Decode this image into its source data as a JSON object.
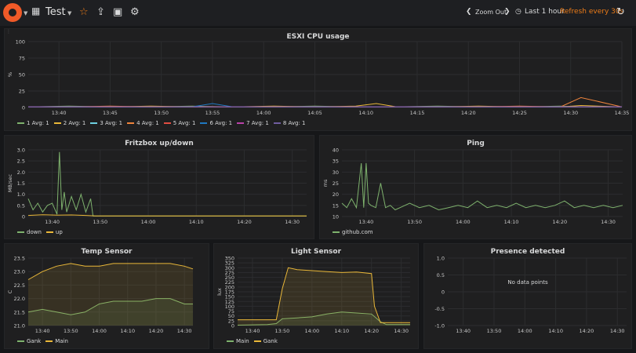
{
  "topbar": {
    "dashboard_title": "Test",
    "zoom_out_label": "Zoom Out",
    "time_range_label": "Last 1 hour",
    "refresh_label": "Refresh every 30s"
  },
  "colors": {
    "accent": "#eb7b18",
    "grid": "#2c2d2f",
    "green": "#7eb26d",
    "yellow": "#eab839"
  },
  "panels": {
    "esxi": {
      "title": "ESXI CPU usage",
      "legend": [
        {
          "label": "1  Avg: 1",
          "color": "#7eb26d"
        },
        {
          "label": "2  Avg: 1",
          "color": "#eab839"
        },
        {
          "label": "3  Avg: 1",
          "color": "#6ed0e0"
        },
        {
          "label": "4  Avg: 1",
          "color": "#ef843c"
        },
        {
          "label": "5  Avg: 1",
          "color": "#e24d42"
        },
        {
          "label": "6  Avg: 1",
          "color": "#1f78c1"
        },
        {
          "label": "7  Avg: 1",
          "color": "#ba43a9"
        },
        {
          "label": "8  Avg: 1",
          "color": "#705da0"
        }
      ]
    },
    "fritz": {
      "title": "Fritzbox up/down",
      "legend": [
        {
          "label": "down",
          "color": "#7eb26d"
        },
        {
          "label": "up",
          "color": "#eab839"
        }
      ]
    },
    "ping": {
      "title": "Ping",
      "legend": [
        {
          "label": "github.com",
          "color": "#7eb26d"
        }
      ]
    },
    "temp": {
      "title": "Temp Sensor",
      "legend": [
        {
          "label": "Gank",
          "color": "#7eb26d"
        },
        {
          "label": "Main",
          "color": "#eab839"
        }
      ]
    },
    "light": {
      "title": "Light Sensor",
      "legend": [
        {
          "label": "Main",
          "color": "#7eb26d"
        },
        {
          "label": "Gank",
          "color": "#eab839"
        }
      ]
    },
    "presence": {
      "title": "Presence detected",
      "no_data": "No data points"
    }
  },
  "chart_data": [
    {
      "id": "esxi",
      "type": "line",
      "title": "ESXI CPU usage",
      "ylabel": "%",
      "ylim": [
        0,
        100
      ],
      "yticks": [
        "0",
        "25",
        "50",
        "75",
        "100"
      ],
      "xlim": [
        0,
        58
      ],
      "xticks": [
        {
          "v": 3,
          "t": "13:40"
        },
        {
          "v": 8,
          "t": "13:45"
        },
        {
          "v": 13,
          "t": "13:50"
        },
        {
          "v": 18,
          "t": "13:55"
        },
        {
          "v": 23,
          "t": "14:00"
        },
        {
          "v": 28,
          "t": "14:05"
        },
        {
          "v": 33,
          "t": "14:10"
        },
        {
          "v": 38,
          "t": "14:15"
        },
        {
          "v": 43,
          "t": "14:20"
        },
        {
          "v": 48,
          "t": "14:25"
        },
        {
          "v": 53,
          "t": "14:30"
        },
        {
          "v": 58,
          "t": "14:35"
        }
      ],
      "series": [
        {
          "name": "1",
          "color": "#7eb26d",
          "x": [
            0,
            4,
            8,
            12,
            16,
            20,
            24,
            28,
            32,
            36,
            40,
            44,
            48,
            52,
            54,
            58
          ],
          "y": [
            1,
            2,
            1,
            1,
            2,
            1,
            1,
            2,
            1,
            1,
            2,
            1,
            1,
            2,
            1,
            1
          ]
        },
        {
          "name": "2",
          "color": "#eab839",
          "x": [
            0,
            4,
            8,
            12,
            16,
            20,
            24,
            28,
            32,
            34,
            36,
            40,
            44,
            48,
            52,
            54,
            58
          ],
          "y": [
            1,
            1,
            1,
            2,
            1,
            1,
            2,
            1,
            2,
            6,
            1,
            1,
            2,
            1,
            1,
            3,
            1
          ]
        },
        {
          "name": "3",
          "color": "#6ed0e0",
          "x": [
            0,
            4,
            8,
            12,
            16,
            20,
            24,
            28,
            32,
            36,
            40,
            44,
            48,
            52,
            58
          ],
          "y": [
            1,
            1,
            1,
            1,
            1,
            1,
            1,
            1,
            1,
            1,
            1,
            1,
            1,
            1,
            1
          ]
        },
        {
          "name": "4",
          "color": "#ef843c",
          "x": [
            0,
            4,
            8,
            12,
            16,
            20,
            24,
            28,
            32,
            36,
            40,
            44,
            48,
            52,
            54,
            58
          ],
          "y": [
            1,
            1,
            2,
            1,
            1,
            1,
            1,
            1,
            1,
            1,
            1,
            1,
            2,
            1,
            15,
            1
          ]
        },
        {
          "name": "5",
          "color": "#e24d42",
          "x": [
            0,
            4,
            8,
            12,
            16,
            20,
            24,
            28,
            32,
            36,
            40,
            44,
            48,
            52,
            58
          ],
          "y": [
            1,
            1,
            1,
            1,
            1,
            1,
            1,
            1,
            1,
            1,
            1,
            1,
            1,
            1,
            1
          ]
        },
        {
          "name": "6",
          "color": "#1f78c1",
          "x": [
            0,
            4,
            8,
            12,
            16,
            18,
            20,
            24,
            28,
            32,
            36,
            40,
            44,
            48,
            52,
            58
          ],
          "y": [
            1,
            1,
            1,
            1,
            1,
            6,
            1,
            1,
            1,
            1,
            1,
            1,
            1,
            1,
            1,
            1
          ]
        },
        {
          "name": "7",
          "color": "#ba43a9",
          "x": [
            0,
            4,
            8,
            12,
            16,
            20,
            24,
            28,
            32,
            36,
            40,
            44,
            48,
            52,
            58
          ],
          "y": [
            1,
            1,
            1,
            1,
            1,
            1,
            1,
            1,
            1,
            1,
            1,
            1,
            1,
            1,
            1
          ]
        },
        {
          "name": "8",
          "color": "#705da0",
          "x": [
            0,
            4,
            8,
            12,
            16,
            20,
            24,
            28,
            32,
            36,
            40,
            44,
            48,
            52,
            58
          ],
          "y": [
            1,
            1,
            1,
            1,
            1,
            1,
            1,
            1,
            1,
            1,
            1,
            1,
            1,
            1,
            1
          ]
        }
      ]
    },
    {
      "id": "fritz",
      "type": "line",
      "title": "Fritzbox up/down",
      "ylabel": "MB/sec",
      "ylim": [
        0,
        3.0
      ],
      "yticks": [
        "0",
        "0.5",
        "1.0",
        "1.5",
        "2.0",
        "2.5",
        "3.0"
      ],
      "xlim": [
        0,
        58
      ],
      "xticks": [
        {
          "v": 5,
          "t": "13:40"
        },
        {
          "v": 15,
          "t": "13:50"
        },
        {
          "v": 25,
          "t": "14:00"
        },
        {
          "v": 35,
          "t": "14:10"
        },
        {
          "v": 45,
          "t": "14:20"
        },
        {
          "v": 55,
          "t": "14:30"
        }
      ],
      "series": [
        {
          "name": "down",
          "color": "#7eb26d",
          "x": [
            0,
            1,
            2,
            3,
            4,
            5,
            6,
            6.5,
            7,
            7.5,
            8,
            9,
            10,
            11,
            12,
            13,
            13.5,
            58
          ],
          "y": [
            0.8,
            0.3,
            0.6,
            0.2,
            0.5,
            0.6,
            0.1,
            2.9,
            0.3,
            1.1,
            0.2,
            0.9,
            0.3,
            1.0,
            0.2,
            0.8,
            0.02,
            0.02
          ]
        },
        {
          "name": "up",
          "color": "#eab839",
          "x": [
            0,
            3,
            6,
            9,
            12,
            14,
            58
          ],
          "y": [
            0.05,
            0.08,
            0.06,
            0.07,
            0.05,
            0.03,
            0.03
          ]
        }
      ]
    },
    {
      "id": "ping",
      "type": "line",
      "title": "Ping",
      "ylabel": "ms",
      "ylim": [
        10,
        40
      ],
      "yticks": [
        "10",
        "15",
        "20",
        "25",
        "30",
        "35",
        "40"
      ],
      "xlim": [
        0,
        58
      ],
      "xticks": [
        {
          "v": 5,
          "t": "13:40"
        },
        {
          "v": 15,
          "t": "13:50"
        },
        {
          "v": 25,
          "t": "14:00"
        },
        {
          "v": 35,
          "t": "14:10"
        },
        {
          "v": 45,
          "t": "14:20"
        },
        {
          "v": 55,
          "t": "14:30"
        }
      ],
      "series": [
        {
          "name": "github.com",
          "color": "#7eb26d",
          "x": [
            0,
            1,
            2,
            3,
            4,
            4.5,
            5,
            5.5,
            6,
            7,
            8,
            9,
            10,
            11,
            12,
            14,
            16,
            18,
            20,
            22,
            24,
            26,
            28,
            30,
            32,
            34,
            36,
            38,
            40,
            42,
            44,
            46,
            48,
            50,
            52,
            54,
            56,
            58
          ],
          "y": [
            16,
            14,
            18,
            14,
            34,
            14,
            34,
            16,
            15,
            14,
            25,
            14,
            15,
            13,
            14,
            16,
            14,
            15,
            13,
            14,
            15,
            14,
            17,
            14,
            15,
            14,
            16,
            14,
            15,
            14,
            15,
            17,
            14,
            15,
            14,
            15,
            14,
            15
          ]
        }
      ]
    },
    {
      "id": "temp",
      "type": "area",
      "title": "Temp Sensor",
      "ylabel": "C",
      "ylim": [
        21.0,
        23.5
      ],
      "yticks": [
        "21.0",
        "21.5",
        "22.0",
        "22.5",
        "23.0",
        "23.5"
      ],
      "xlim": [
        0,
        58
      ],
      "xticks": [
        {
          "v": 5,
          "t": "13:40"
        },
        {
          "v": 15,
          "t": "13:50"
        },
        {
          "v": 25,
          "t": "14:00"
        },
        {
          "v": 35,
          "t": "14:10"
        },
        {
          "v": 45,
          "t": "14:20"
        },
        {
          "v": 55,
          "t": "14:30"
        }
      ],
      "series": [
        {
          "name": "Gank",
          "color": "#7eb26d",
          "x": [
            0,
            5,
            10,
            15,
            20,
            25,
            30,
            35,
            40,
            45,
            50,
            55,
            58
          ],
          "y": [
            21.5,
            21.6,
            21.5,
            21.4,
            21.5,
            21.8,
            21.9,
            21.9,
            21.9,
            22.0,
            22.0,
            21.8,
            21.8
          ]
        },
        {
          "name": "Main",
          "color": "#eab839",
          "x": [
            0,
            5,
            10,
            15,
            20,
            25,
            30,
            35,
            40,
            45,
            50,
            55,
            58
          ],
          "y": [
            22.7,
            23.0,
            23.2,
            23.3,
            23.2,
            23.2,
            23.3,
            23.3,
            23.3,
            23.3,
            23.3,
            23.2,
            23.1
          ]
        }
      ]
    },
    {
      "id": "light",
      "type": "area",
      "title": "Light Sensor",
      "ylabel": "lux",
      "ylim": [
        0,
        350
      ],
      "yticks": [
        "0",
        "25",
        "50",
        "75",
        "100",
        "125",
        "150",
        "175",
        "200",
        "225",
        "250",
        "275",
        "300",
        "325",
        "350"
      ],
      "xlim": [
        0,
        58
      ],
      "xticks": [
        {
          "v": 5,
          "t": "13:40"
        },
        {
          "v": 15,
          "t": "13:50"
        },
        {
          "v": 25,
          "t": "14:00"
        },
        {
          "v": 35,
          "t": "14:10"
        },
        {
          "v": 45,
          "t": "14:20"
        },
        {
          "v": 55,
          "t": "14:30"
        }
      ],
      "series": [
        {
          "name": "Main",
          "color": "#7eb26d",
          "x": [
            0,
            10,
            13,
            15,
            20,
            25,
            30,
            35,
            40,
            45,
            48,
            50,
            58
          ],
          "y": [
            2,
            5,
            10,
            35,
            40,
            45,
            60,
            70,
            65,
            60,
            20,
            5,
            5
          ]
        },
        {
          "name": "Gank",
          "color": "#eab839",
          "x": [
            0,
            10,
            13,
            15,
            17,
            20,
            25,
            30,
            35,
            40,
            45,
            46,
            48,
            50,
            58
          ],
          "y": [
            30,
            30,
            30,
            190,
            300,
            290,
            285,
            280,
            275,
            278,
            270,
            100,
            15,
            15,
            15
          ]
        }
      ]
    },
    {
      "id": "presence",
      "type": "line",
      "title": "Presence detected",
      "ylabel": "",
      "ylim": [
        -1.0,
        1.0
      ],
      "yticks": [
        "-1.0",
        "-0.5",
        "0",
        "0.5",
        "1.0"
      ],
      "xlim": [
        0,
        58
      ],
      "xticks": [
        {
          "v": 5,
          "t": "13:40"
        },
        {
          "v": 15,
          "t": "13:50"
        },
        {
          "v": 25,
          "t": "14:00"
        },
        {
          "v": 35,
          "t": "14:10"
        },
        {
          "v": 45,
          "t": "14:20"
        },
        {
          "v": 55,
          "t": "14:30"
        }
      ],
      "series": []
    }
  ]
}
